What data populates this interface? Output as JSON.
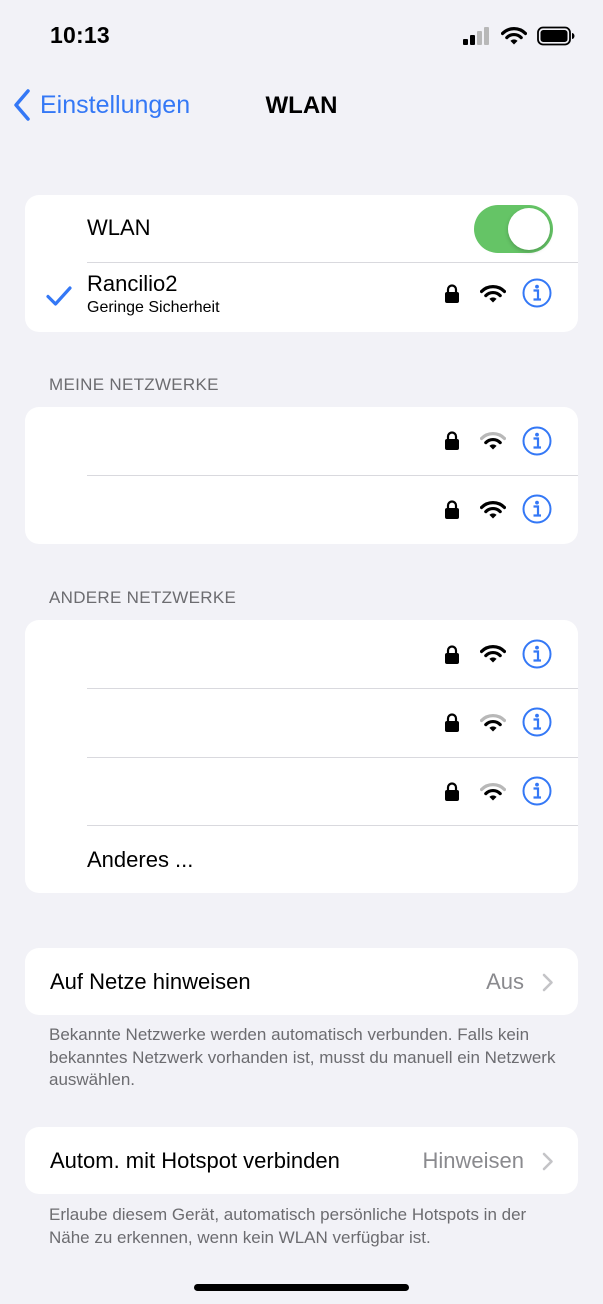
{
  "status_bar": {
    "time": "10:13",
    "icons": [
      "cellular-signal-icon",
      "wifi-icon",
      "battery-icon"
    ]
  },
  "nav": {
    "back_label": "Einstellungen",
    "title": "WLAN"
  },
  "wlan_card": {
    "toggle_label": "WLAN",
    "toggle_on": true,
    "connected_network": {
      "name": "Rancilio2",
      "subtitle": "Geringe Sicherheit"
    }
  },
  "my_networks": {
    "header": "MEINE NETZWERKE",
    "rows": [
      {
        "name": "",
        "wifi_strength": "medium"
      },
      {
        "name": "",
        "wifi_strength": "full"
      }
    ]
  },
  "other_networks": {
    "header": "ANDERE NETZWERKE",
    "rows": [
      {
        "name": "",
        "wifi_strength": "full"
      },
      {
        "name": "",
        "wifi_strength": "medium"
      },
      {
        "name": "",
        "wifi_strength": "medium"
      }
    ],
    "other_label": "Anderes ..."
  },
  "ask_to_join": {
    "label": "Auf Netze hinweisen",
    "value": "Aus",
    "footnote": "Bekannte Netzwerke werden automatisch verbunden. Falls kein bekanntes Netzwerk vorhanden ist, musst du manuell ein Netzwerk auswählen."
  },
  "hotspot": {
    "label": "Autom. mit Hotspot verbinden",
    "value": "Hinweisen",
    "footnote": "Erlaube diesem Gerät, automatisch persönliche Hotspots in der Nähe zu erkennen, wenn kein WLAN verfügbar ist."
  },
  "colors": {
    "accent": "#3478f6",
    "toggle_on": "#65c466",
    "background": "#f2f2f7",
    "secondary_text": "#6c6c70"
  }
}
